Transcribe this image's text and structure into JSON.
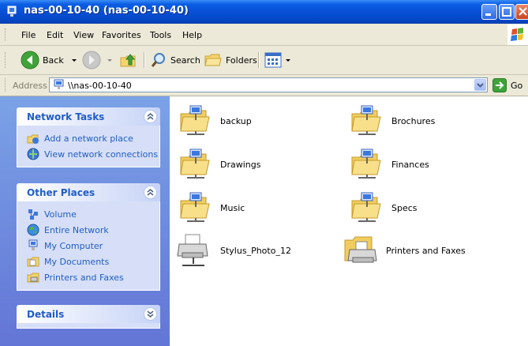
{
  "window": {
    "title": "nas-00-10-40 (nas-00-10-40)"
  },
  "menu": [
    "File",
    "Edit",
    "View",
    "Favorites",
    "Tools",
    "Help"
  ],
  "toolbar": {
    "back_label": "Back",
    "search_label": "Search",
    "folders_label": "Folders"
  },
  "address": {
    "label": "Address",
    "value": "\\\\nas-00-10-40",
    "go_label": "Go"
  },
  "sidebar": {
    "network_tasks": {
      "title": "Network Tasks",
      "items": [
        "Add a network place",
        "View network connections"
      ]
    },
    "other_places": {
      "title": "Other Places",
      "items": [
        "Volume",
        "Entire Network",
        "My Computer",
        "My Documents",
        "Printers and Faxes"
      ]
    },
    "details": {
      "title": "Details"
    }
  },
  "items": [
    {
      "name": "backup",
      "type": "share"
    },
    {
      "name": "Brochures",
      "type": "share"
    },
    {
      "name": "Drawings",
      "type": "share"
    },
    {
      "name": "Finances",
      "type": "share"
    },
    {
      "name": "Music",
      "type": "share"
    },
    {
      "name": "Specs",
      "type": "share"
    },
    {
      "name": "Stylus_Photo_12",
      "type": "printer"
    },
    {
      "name": "Printers and Faxes",
      "type": "printers-folder"
    }
  ],
  "colors": {
    "titlebar": "#0850d6",
    "sidebar": "#7ba2e7",
    "panel_title": "#215dc6",
    "chrome": "#ece9d8"
  }
}
